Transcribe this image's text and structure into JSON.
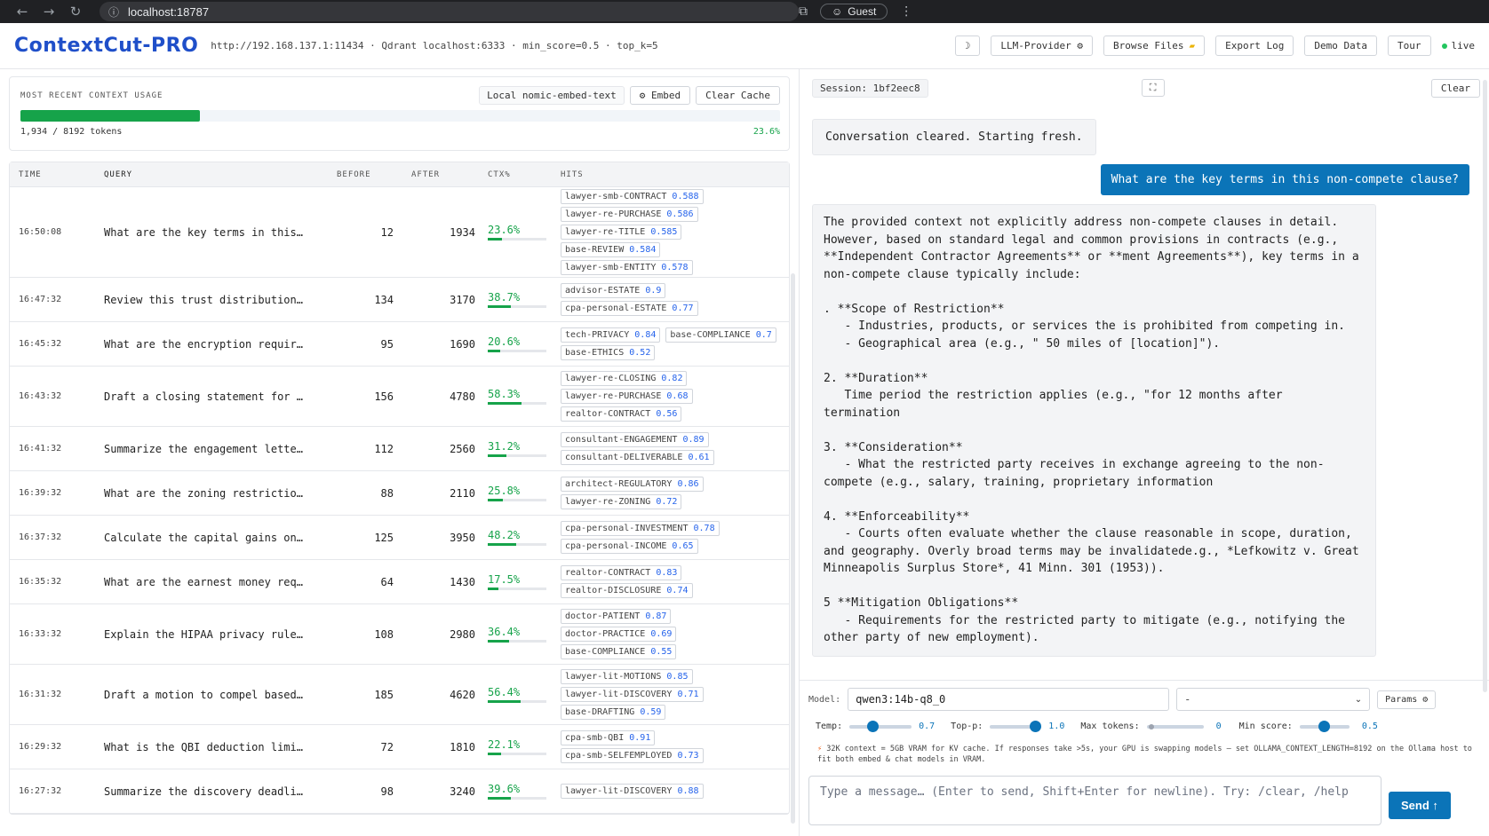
{
  "browser": {
    "url": "localhost:18787",
    "profile": "Guest"
  },
  "header": {
    "logo": "ContextCut-PRO",
    "connection": "http://192.168.137.1:11434 · Qdrant localhost:6333 · min_score=0.5 · top_k=5",
    "buttons": {
      "theme": "☽",
      "llm_provider": "LLM-Provider ⚙",
      "browse_files": "Browse Files",
      "export_log": "Export Log",
      "demo_data": "Demo Data",
      "tour": "Tour"
    },
    "live": "live"
  },
  "usage": {
    "label": "MOST RECENT CONTEXT USAGE",
    "embed_model": "Local nomic-embed-text",
    "embed_button": "⚙ Embed",
    "clear_cache": "Clear Cache",
    "tokens": "1,934 / 8192 tokens",
    "percent_text": "23.6%",
    "fraction": 0.236
  },
  "table": {
    "headers": {
      "time": "TIME",
      "query": "QUERY",
      "before": "BEFORE",
      "after": "AFTER",
      "ctx": "CTX%",
      "hits": "HITS"
    },
    "rows": [
      {
        "time": "16:50:08",
        "query": "What are the key terms in this…",
        "before": "12",
        "after": "1934",
        "ctx": "23.6%",
        "ctx_frac": 0.236,
        "hits": [
          {
            "n": "lawyer-smb-CONTRACT",
            "s": "0.588"
          },
          {
            "n": "lawyer-re-PURCHASE",
            "s": "0.586"
          },
          {
            "n": "lawyer-re-TITLE",
            "s": "0.585"
          },
          {
            "n": "base-REVIEW",
            "s": "0.584"
          },
          {
            "n": "lawyer-smb-ENTITY",
            "s": "0.578"
          }
        ]
      },
      {
        "time": "16:47:32",
        "query": "Review this trust distribution…",
        "before": "134",
        "after": "3170",
        "ctx": "38.7%",
        "ctx_frac": 0.387,
        "hits": [
          {
            "n": "advisor-ESTATE",
            "s": "0.9"
          },
          {
            "n": "cpa-personal-ESTATE",
            "s": "0.77"
          }
        ]
      },
      {
        "time": "16:45:32",
        "query": "What are the encryption requir…",
        "before": "95",
        "after": "1690",
        "ctx": "20.6%",
        "ctx_frac": 0.206,
        "hits": [
          {
            "n": "tech-PRIVACY",
            "s": "0.84"
          },
          {
            "n": "base-COMPLIANCE",
            "s": "0.7"
          },
          {
            "n": "base-ETHICS",
            "s": "0.52"
          }
        ]
      },
      {
        "time": "16:43:32",
        "query": "Draft a closing statement for …",
        "before": "156",
        "after": "4780",
        "ctx": "58.3%",
        "ctx_frac": 0.583,
        "hits": [
          {
            "n": "lawyer-re-CLOSING",
            "s": "0.82"
          },
          {
            "n": "lawyer-re-PURCHASE",
            "s": "0.68"
          },
          {
            "n": "realtor-CONTRACT",
            "s": "0.56"
          }
        ]
      },
      {
        "time": "16:41:32",
        "query": "Summarize the engagement lette…",
        "before": "112",
        "after": "2560",
        "ctx": "31.2%",
        "ctx_frac": 0.312,
        "hits": [
          {
            "n": "consultant-ENGAGEMENT",
            "s": "0.89"
          },
          {
            "n": "consultant-DELIVERABLE",
            "s": "0.61"
          }
        ]
      },
      {
        "time": "16:39:32",
        "query": "What are the zoning restrictio…",
        "before": "88",
        "after": "2110",
        "ctx": "25.8%",
        "ctx_frac": 0.258,
        "hits": [
          {
            "n": "architect-REGULATORY",
            "s": "0.86"
          },
          {
            "n": "lawyer-re-ZONING",
            "s": "0.72"
          }
        ]
      },
      {
        "time": "16:37:32",
        "query": "Calculate the capital gains on…",
        "before": "125",
        "after": "3950",
        "ctx": "48.2%",
        "ctx_frac": 0.482,
        "hits": [
          {
            "n": "cpa-personal-INVESTMENT",
            "s": "0.78"
          },
          {
            "n": "cpa-personal-INCOME",
            "s": "0.65"
          }
        ]
      },
      {
        "time": "16:35:32",
        "query": "What are the earnest money req…",
        "before": "64",
        "after": "1430",
        "ctx": "17.5%",
        "ctx_frac": 0.175,
        "hits": [
          {
            "n": "realtor-CONTRACT",
            "s": "0.83"
          },
          {
            "n": "realtor-DISCLOSURE",
            "s": "0.74"
          }
        ]
      },
      {
        "time": "16:33:32",
        "query": "Explain the HIPAA privacy rule…",
        "before": "108",
        "after": "2980",
        "ctx": "36.4%",
        "ctx_frac": 0.364,
        "hits": [
          {
            "n": "doctor-PATIENT",
            "s": "0.87"
          },
          {
            "n": "doctor-PRACTICE",
            "s": "0.69"
          },
          {
            "n": "base-COMPLIANCE",
            "s": "0.55"
          }
        ]
      },
      {
        "time": "16:31:32",
        "query": "Draft a motion to compel based…",
        "before": "185",
        "after": "4620",
        "ctx": "56.4%",
        "ctx_frac": 0.564,
        "hits": [
          {
            "n": "lawyer-lit-MOTIONS",
            "s": "0.85"
          },
          {
            "n": "lawyer-lit-DISCOVERY",
            "s": "0.71"
          },
          {
            "n": "base-DRAFTING",
            "s": "0.59"
          }
        ]
      },
      {
        "time": "16:29:32",
        "query": "What is the QBI deduction limi…",
        "before": "72",
        "after": "1810",
        "ctx": "22.1%",
        "ctx_frac": 0.221,
        "hits": [
          {
            "n": "cpa-smb-QBI",
            "s": "0.91"
          },
          {
            "n": "cpa-smb-SELFEMPLOYED",
            "s": "0.73"
          }
        ]
      },
      {
        "time": "16:27:32",
        "query": "Summarize the discovery deadli…",
        "before": "98",
        "after": "3240",
        "ctx": "39.6%",
        "ctx_frac": 0.396,
        "hits": [
          {
            "n": "lawyer-lit-DISCOVERY",
            "s": "0.88"
          }
        ]
      }
    ]
  },
  "chat": {
    "session": "Session: 1bf2eec8",
    "clear": "Clear",
    "system_msg": "Conversation cleared. Starting fresh.",
    "user_msg": "What are the key terms in this non-compete clause?",
    "bot_msg": "The provided context not explicitly address non-compete clauses in detail.\nHowever, based on standard legal and common provisions in contracts (e.g.,\n**Independent Contractor Agreements** or **ment Agreements**), key terms in a\nnon-compete clause typically include:\n\n. **Scope of Restriction**\n   - Industries, products, or services the is prohibited from competing in.\n   - Geographical area (e.g., \" 50 miles of [location]\").\n\n2. **Duration**\n   Time period the restriction applies (e.g., \"for 12 months after termination\n\n3. **Consideration**\n   - What the restricted party receives in exchange agreeing to the non-\ncompete (e.g., salary, training, proprietary information\n\n4. **Enforceability**\n   - Courts often evaluate whether the clause reasonable in scope, duration,\nand geography. Overly broad terms may be invalidatede.g., *Lefkowitz v. Great\nMinneapolis Surplus Store*, 41 Minn. 301 (1953)).\n\n5 **Mitigation Obligations**\n   - Requirements for the restricted party to mitigate (e.g., notifying the\nother party of new employment)."
  },
  "controls": {
    "model_label": "Model:",
    "model_value": "qwen3:14b-q8_0",
    "select_value": "-",
    "params": "Params ⚙",
    "temp_label": "Temp:",
    "temp_value": "0.7",
    "temp_frac": 0.35,
    "topp_label": "Top-p:",
    "topp_value": "1.0",
    "topp_frac": 1.0,
    "maxtok_label": "Max tokens:",
    "maxtok_value": "0",
    "maxtok_frac": 0.05,
    "minscore_label": "Min score:",
    "minscore_value": "0.5",
    "minscore_frac": 0.5,
    "warning": "32K context = 5GB VRAM for KV cache. If responses take >5s, your GPU is swapping models — set OLLAMA_CONTEXT_LENGTH=8192 on the Ollama host to fit both embed & chat models in VRAM.",
    "placeholder": "Type a message… (Enter to send, Shift+Enter for newline). Try: /clear, /help",
    "send": "Send ↑"
  }
}
